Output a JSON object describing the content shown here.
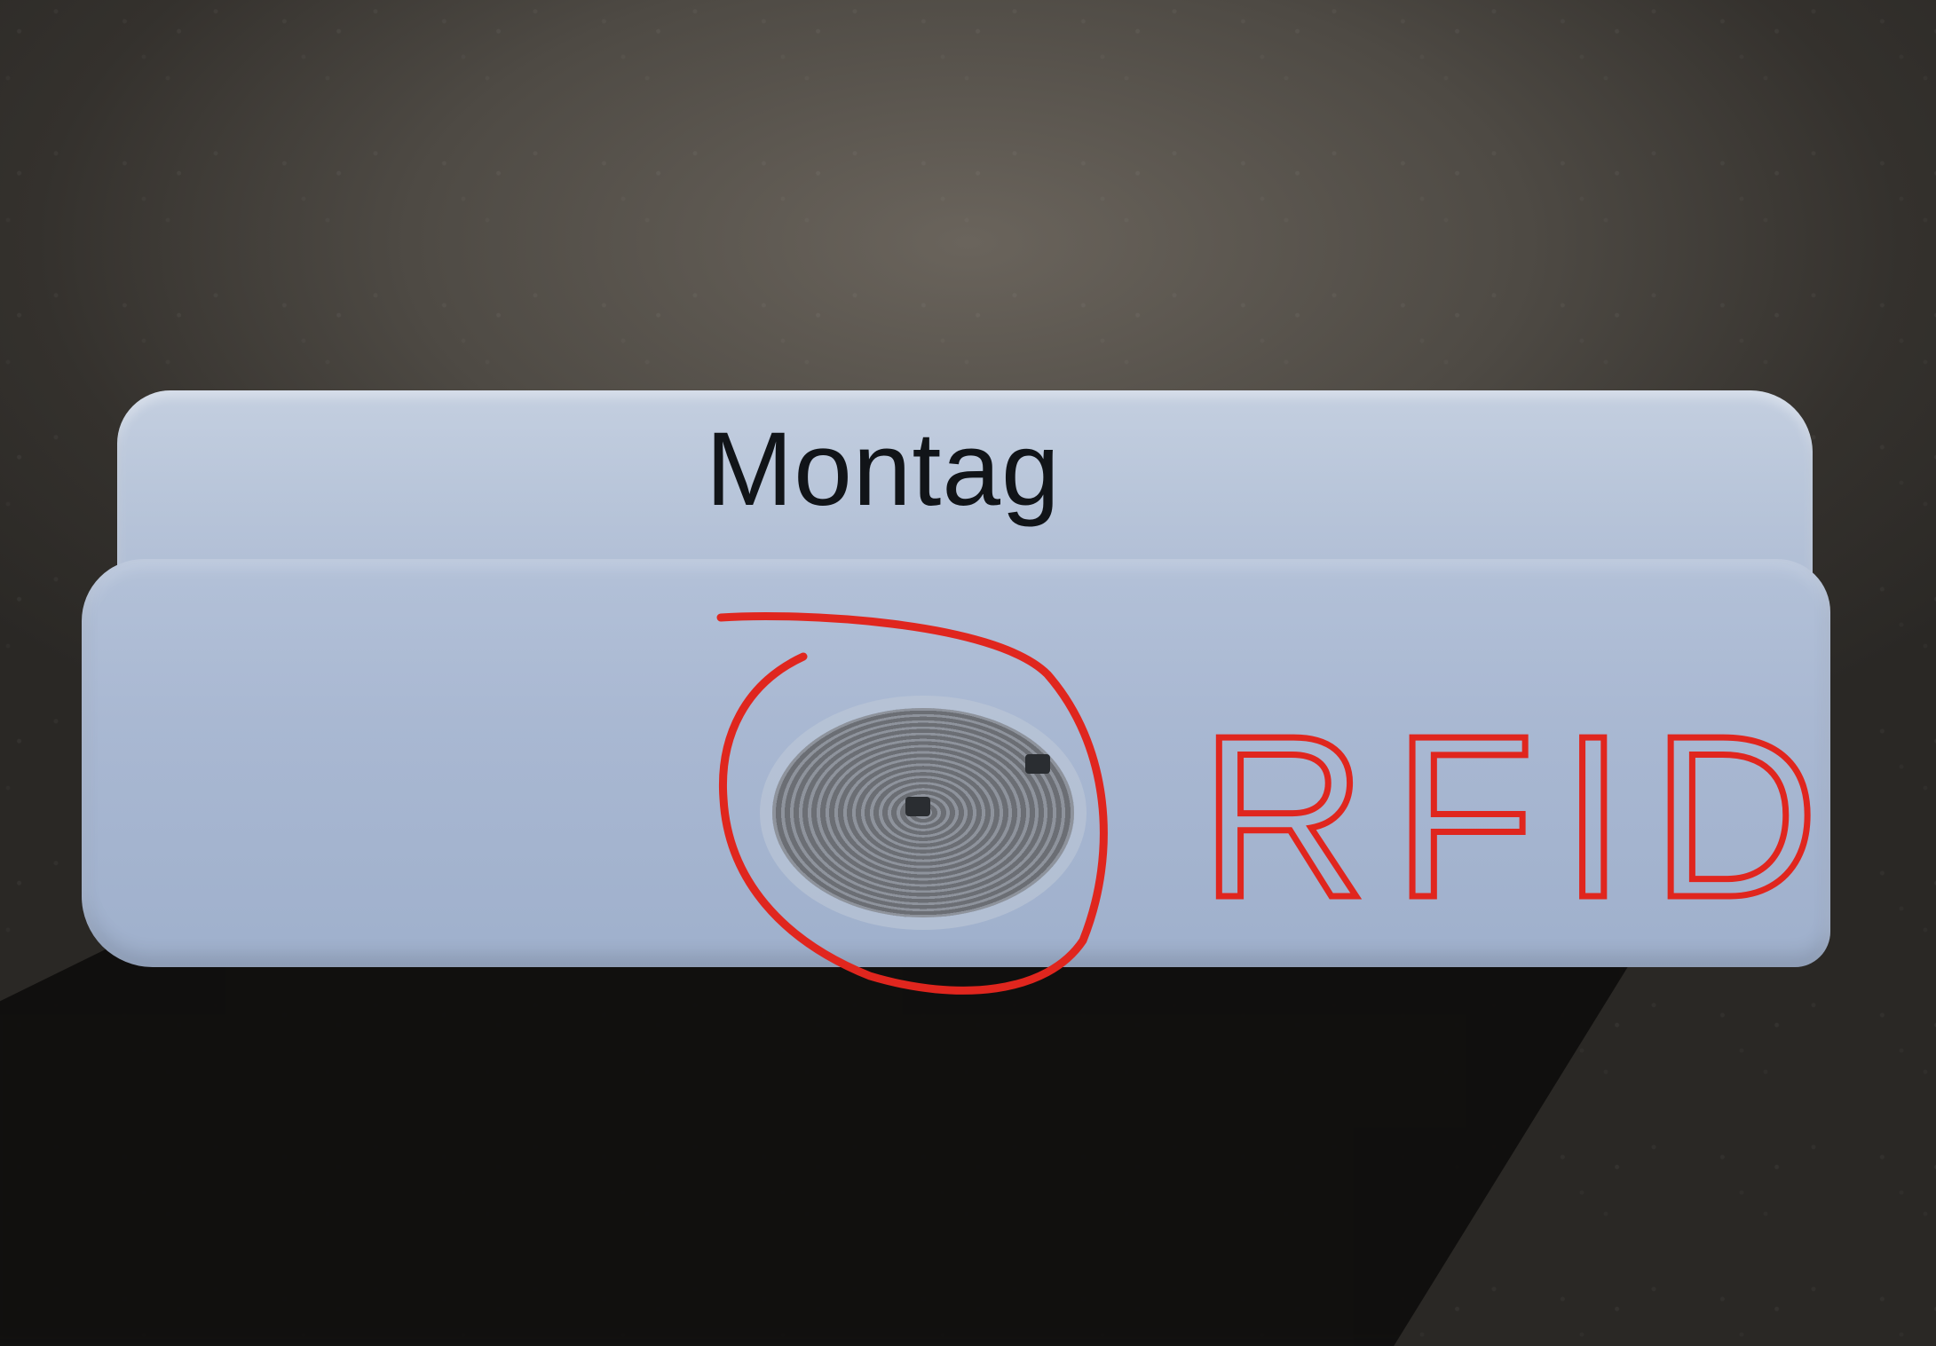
{
  "photo": {
    "device_label": "Montag",
    "annotation_text": "RFID"
  },
  "colors": {
    "device": "#b3c1d8",
    "annotation": "#e0261e",
    "surface": "#4e4a44"
  }
}
